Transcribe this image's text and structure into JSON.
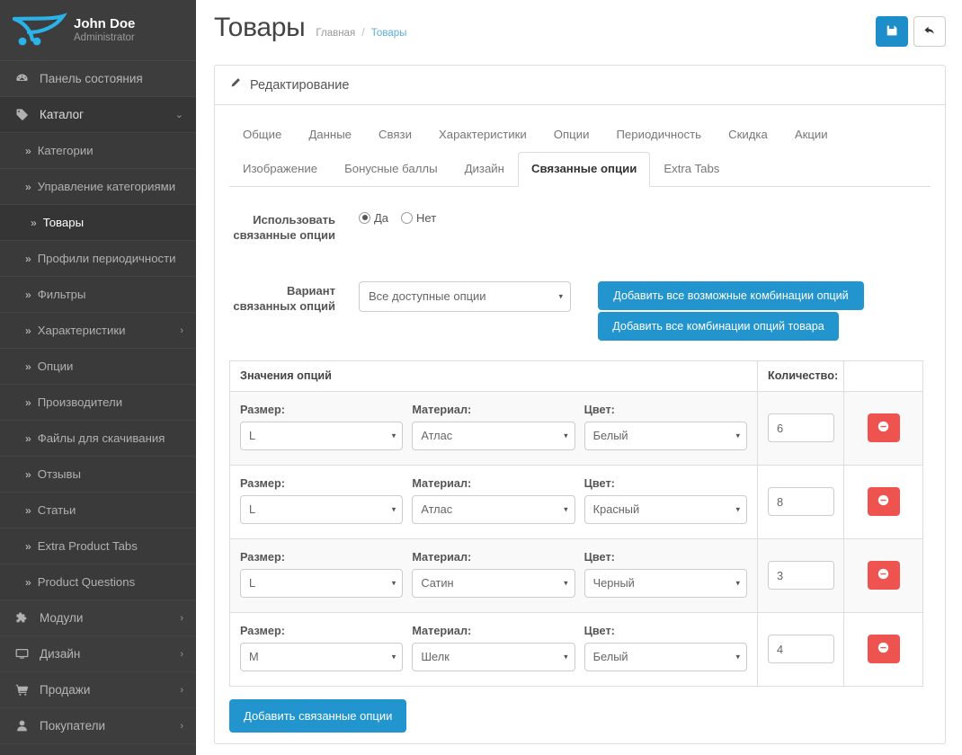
{
  "sidebar": {
    "profile": {
      "name": "John Doe",
      "role": "Administrator",
      "logo_icon": "opencart-logo-icon"
    },
    "items": [
      {
        "label": "Панель состояния",
        "icon": "dashboard-icon",
        "type": "top",
        "caret": ""
      },
      {
        "label": "Каталог",
        "icon": "tag-icon",
        "type": "top",
        "caret": "⌄",
        "active": true
      },
      {
        "label": "Категории",
        "icon": "chevron-double-right-icon",
        "type": "sub"
      },
      {
        "label": "Управление категориями",
        "icon": "chevron-double-right-icon",
        "type": "sub"
      },
      {
        "label": "Товары",
        "icon": "chevron-double-right-icon",
        "type": "sub",
        "selected": true
      },
      {
        "label": "Профили периодичности",
        "icon": "chevron-double-right-icon",
        "type": "sub"
      },
      {
        "label": "Фильтры",
        "icon": "chevron-double-right-icon",
        "type": "sub"
      },
      {
        "label": "Характеристики",
        "icon": "chevron-double-right-icon",
        "type": "sub",
        "caret": "›"
      },
      {
        "label": "Опции",
        "icon": "chevron-double-right-icon",
        "type": "sub"
      },
      {
        "label": "Производители",
        "icon": "chevron-double-right-icon",
        "type": "sub"
      },
      {
        "label": "Файлы для скачивания",
        "icon": "chevron-double-right-icon",
        "type": "sub"
      },
      {
        "label": "Отзывы",
        "icon": "chevron-double-right-icon",
        "type": "sub"
      },
      {
        "label": "Статьи",
        "icon": "chevron-double-right-icon",
        "type": "sub"
      },
      {
        "label": "Extra Product Tabs",
        "icon": "chevron-double-right-icon",
        "type": "sub"
      },
      {
        "label": "Product Questions",
        "icon": "chevron-double-right-icon",
        "type": "sub"
      },
      {
        "label": "Модули",
        "icon": "puzzle-icon",
        "type": "top",
        "caret": "›"
      },
      {
        "label": "Дизайн",
        "icon": "monitor-icon",
        "type": "top",
        "caret": "›"
      },
      {
        "label": "Продажи",
        "icon": "cart-icon",
        "type": "top",
        "caret": "›"
      },
      {
        "label": "Покупатели",
        "icon": "user-icon",
        "type": "top",
        "caret": "›"
      }
    ]
  },
  "header": {
    "title": "Товары",
    "breadcrumb": {
      "home": "Главная",
      "sep": "/",
      "current": "Товары"
    },
    "save_icon": "floppy-save-icon",
    "back_icon": "back-arrow-icon"
  },
  "panel": {
    "heading": "Редактирование",
    "heading_icon": "pencil-icon"
  },
  "tabs": {
    "row1": [
      {
        "label": "Общие"
      },
      {
        "label": "Данные"
      },
      {
        "label": "Связи"
      },
      {
        "label": "Характеристики"
      },
      {
        "label": "Опции"
      },
      {
        "label": "Периодичность"
      },
      {
        "label": "Скидка"
      },
      {
        "label": "Акции"
      }
    ],
    "row2": [
      {
        "label": "Изображение"
      },
      {
        "label": "Бонусные баллы"
      },
      {
        "label": "Дизайн"
      },
      {
        "label": "Связанные опции",
        "active": true
      },
      {
        "label": "Extra Tabs"
      }
    ]
  },
  "form": {
    "use_linked": {
      "label": "Использовать связанные опции",
      "options": [
        {
          "label": "Да",
          "checked": true
        },
        {
          "label": "Нет",
          "checked": false
        }
      ]
    },
    "variant": {
      "label": "Вариант связанных опций",
      "selected": "Все доступные опции",
      "caret": "▾"
    },
    "buttons": {
      "all_possible": "Добавить все возможные комбинации опций",
      "product_combos": "Добавить все комбинации опций товара"
    }
  },
  "table": {
    "headers": {
      "values": "Значения опций",
      "quantity": "Количество:",
      "actions": ""
    },
    "field_labels": {
      "size": "Размер:",
      "material": "Материал:",
      "color": "Цвет:"
    },
    "caret": "▾",
    "remove_icon": "minus-circle-icon",
    "rows": [
      {
        "size": "L",
        "material": "Атлас",
        "color": "Белый",
        "quantity": "6"
      },
      {
        "size": "L",
        "material": "Атлас",
        "color": "Красный",
        "quantity": "8"
      },
      {
        "size": "L",
        "material": "Сатин",
        "color": "Черный",
        "quantity": "3"
      },
      {
        "size": "M",
        "material": "Шелк",
        "color": "Белый",
        "quantity": "4"
      }
    ]
  },
  "footer": {
    "add_linked_options": "Добавить связанные опции"
  },
  "colors": {
    "sidebar_bg": "#3d3d3d",
    "accent_blue": "#2294ce",
    "save_blue": "#1e8ecb",
    "danger_red": "#ef5350",
    "link_blue": "#5bacdc",
    "logo_blue": "#2bb3e8"
  }
}
